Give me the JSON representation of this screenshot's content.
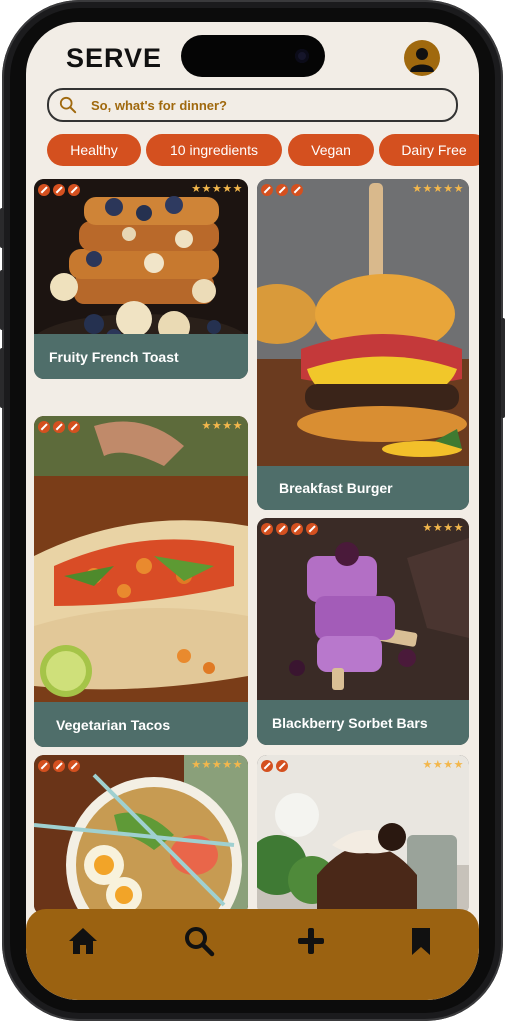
{
  "app": {
    "title": "SERVE"
  },
  "search": {
    "placeholder": "So, what's for dinner?"
  },
  "filters": [
    "Healthy",
    "10 ingredients",
    "Vegan",
    "Dairy Free"
  ],
  "recipes": [
    {
      "name": "Fruity French Toast",
      "rating": 5,
      "stars": "★★★★★"
    },
    {
      "name": "Breakfast Burger",
      "rating": 5,
      "stars": "★★★★★"
    },
    {
      "name": "Vegetarian Tacos",
      "rating": 4,
      "stars": "★★★★"
    },
    {
      "name": "Blackberry Sorbet Bars",
      "rating": 4,
      "stars": "★★★★"
    },
    {
      "name": "",
      "rating": 5,
      "stars": "★★★★★"
    },
    {
      "name": "",
      "rating": 4,
      "stars": "★★★★"
    }
  ],
  "nav": {
    "items": [
      {
        "icon": "home-icon"
      },
      {
        "icon": "search-icon"
      },
      {
        "icon": "plus-icon"
      },
      {
        "icon": "bookmark-icon"
      }
    ]
  },
  "colors": {
    "accent": "#d4501f",
    "brand_brown": "#9b6211",
    "caption": "#4f6e6a",
    "background": "#f2ede6",
    "star": "#f3b74c"
  }
}
